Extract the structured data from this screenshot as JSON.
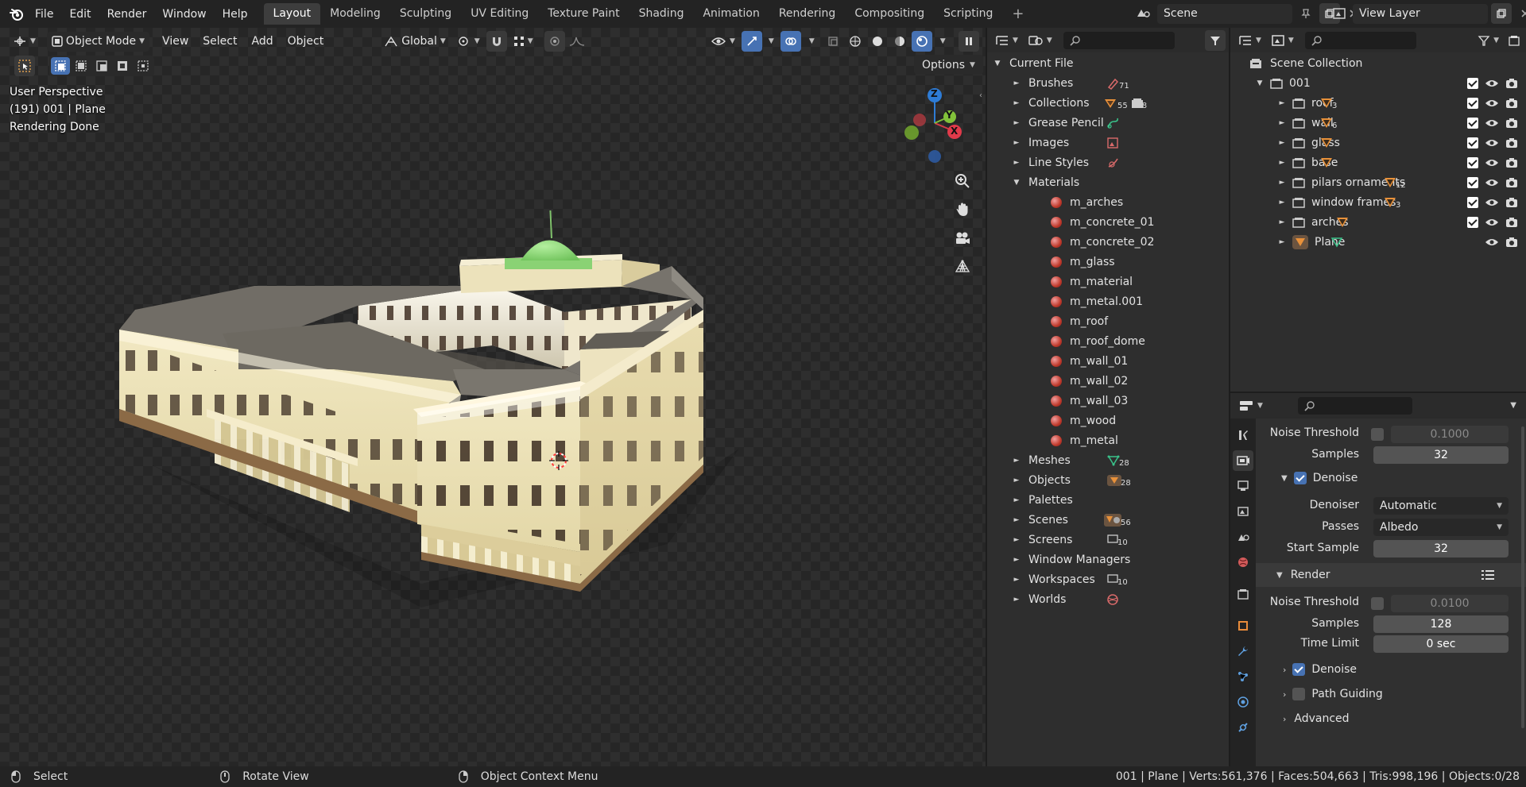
{
  "topbar": {
    "menus": [
      "File",
      "Edit",
      "Render",
      "Window",
      "Help"
    ],
    "workspaces": [
      "Layout",
      "Modeling",
      "Sculpting",
      "UV Editing",
      "Texture Paint",
      "Shading",
      "Animation",
      "Rendering",
      "Compositing",
      "Scripting"
    ],
    "active_workspace": "Layout",
    "add_tab": "+",
    "scene": "Scene",
    "view_layer": "View Layer"
  },
  "viewport": {
    "mode": "Object Mode",
    "menus": [
      "View",
      "Select",
      "Add",
      "Object"
    ],
    "orientation": "Global",
    "options": "Options",
    "info": [
      "User Perspective",
      "(191) 001 | Plane",
      "Rendering Done"
    ],
    "gizmo": {
      "z": "Z",
      "y": "Y",
      "x": "X"
    }
  },
  "outliner_file": {
    "root": "Current File",
    "items": [
      {
        "label": "Brushes",
        "count": "71"
      },
      {
        "label": "Collections",
        "count": "55",
        "count2": "8"
      },
      {
        "label": "Grease Pencil",
        "count": ""
      },
      {
        "label": "Images",
        "count": ""
      },
      {
        "label": "Line Styles",
        "count": ""
      },
      {
        "label": "Materials",
        "count": "",
        "expanded": true
      },
      {
        "label": "Meshes",
        "count": "28"
      },
      {
        "label": "Objects",
        "count": "28"
      },
      {
        "label": "Palettes",
        "count": ""
      },
      {
        "label": "Scenes",
        "count": "56"
      },
      {
        "label": "Screens",
        "count": "10"
      },
      {
        "label": "Window Managers",
        "count": ""
      },
      {
        "label": "Workspaces",
        "count": "10"
      },
      {
        "label": "Worlds",
        "count": ""
      }
    ],
    "materials": [
      "m_arches",
      "m_concrete_01",
      "m_concrete_02",
      "m_glass",
      "m_material",
      "m_metal.001",
      "m_roof",
      "m_roof_dome",
      "m_wall_01",
      "m_wall_02",
      "m_wall_03",
      "m_wood",
      "m_metal"
    ]
  },
  "outliner_scene": {
    "root": "Scene Collection",
    "collection": "001",
    "children": [
      {
        "label": "roof",
        "count": "3"
      },
      {
        "label": "wall",
        "count": "6"
      },
      {
        "label": "glass",
        "count": ""
      },
      {
        "label": "base",
        "count": ""
      },
      {
        "label": "pilars ornaments",
        "count": "12"
      },
      {
        "label": "window frames",
        "count": "3"
      },
      {
        "label": "arches",
        "count": ""
      },
      {
        "label": "Plane",
        "count": ""
      }
    ]
  },
  "properties": {
    "noise_threshold_label": "Noise Threshold",
    "noise_threshold_1": "0.1000",
    "samples_label": "Samples",
    "samples_1": "32",
    "denoise_label": "Denoise",
    "denoiser_label": "Denoiser",
    "denoiser": "Automatic",
    "passes_label": "Passes",
    "passes": "Albedo",
    "start_sample_label": "Start Sample",
    "start_sample": "32",
    "render_label": "Render",
    "noise_threshold_2": "0.0100",
    "samples_2": "128",
    "time_limit_label": "Time Limit",
    "time_limit": "0 sec",
    "denoise2_label": "Denoise",
    "path_guiding_label": "Path Guiding",
    "advanced_label": "Advanced"
  },
  "statusbar": {
    "select": "Select",
    "rotate": "Rotate View",
    "context": "Object Context Menu",
    "stats": "001 | Plane | Verts:561,376 | Faces:504,663 | Tris:998,196 | Objects:0/28"
  },
  "colors": {
    "accent": "#4772b3",
    "building": "#e8dfb5",
    "roof": "#6f6c64",
    "dome": "#8fd878"
  }
}
